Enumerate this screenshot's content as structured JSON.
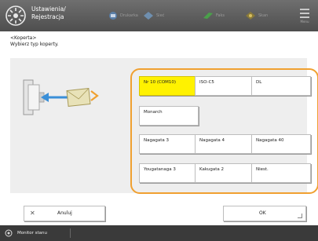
{
  "header": {
    "title_line1": "Ustawienia/",
    "title_line2": "Rejestracja",
    "status_items": [
      {
        "icon": "printer-icon",
        "label": "Drukarka"
      },
      {
        "icon": "network-icon",
        "label": "Sieć"
      },
      {
        "icon": "fax-icon",
        "label": "Faks"
      },
      {
        "icon": "scan-icon",
        "label": "Skan"
      }
    ],
    "menu_label": "Menu"
  },
  "page": {
    "heading": "<Koperta>",
    "subheading": "Wybierz typ koperty."
  },
  "envelope_options": [
    {
      "label": "Nr 10 (COM10)",
      "selected": true
    },
    {
      "label": "ISO-C5",
      "selected": false
    },
    {
      "label": "DL",
      "selected": false
    },
    {
      "label": "Monarch",
      "selected": false
    },
    {
      "label": "Nagagata 3",
      "selected": false
    },
    {
      "label": "Nagagata 4",
      "selected": false
    },
    {
      "label": "Nagagata 40",
      "selected": false
    },
    {
      "label": "Yougatanaga 3",
      "selected": false
    },
    {
      "label": "Kakugata 2",
      "selected": false
    },
    {
      "label": "Niest.",
      "selected": false
    }
  ],
  "buttons": {
    "cancel_label": "Anuluj",
    "ok_label": "OK"
  },
  "footer": {
    "status_monitor_label": "Monitor stanu"
  },
  "colors": {
    "selected": "#fff200",
    "frame": "#f0a030",
    "arrow": "#3a8fd8"
  }
}
